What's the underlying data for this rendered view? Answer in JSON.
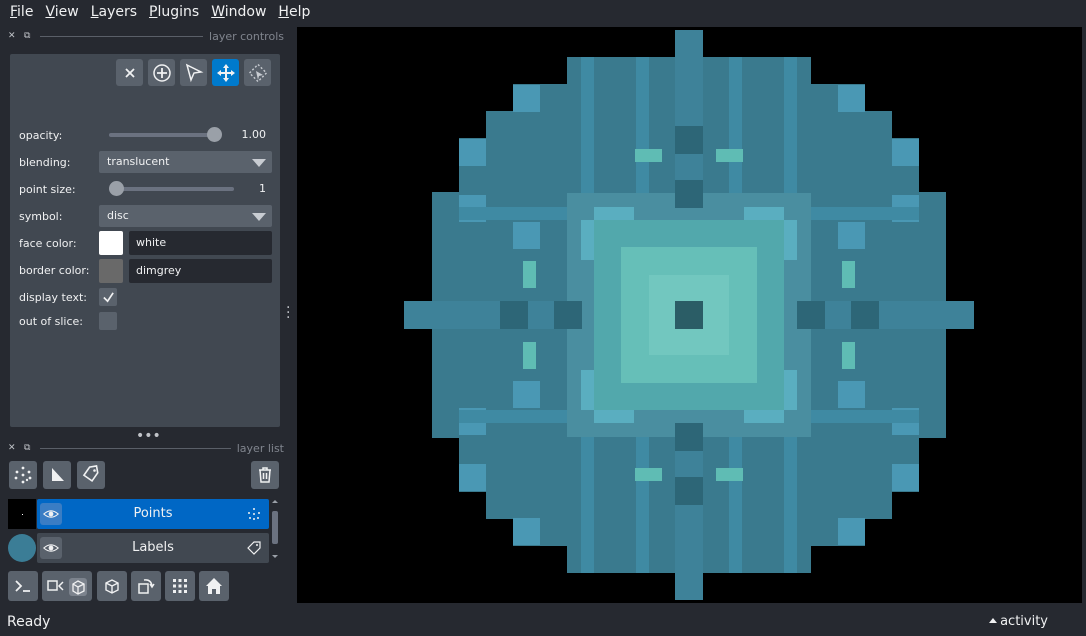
{
  "menu": [
    "File",
    "View",
    "Layers",
    "Plugins",
    "Window",
    "Help"
  ],
  "layer_controls": {
    "title": "layer controls",
    "opacity": {
      "label": "opacity:",
      "value": "1.00",
      "fraction": 1.0
    },
    "blending": {
      "label": "blending:",
      "value": "translucent"
    },
    "point_size": {
      "label": "point size:",
      "value": "1",
      "fraction": 0.0
    },
    "symbol": {
      "label": "symbol:",
      "value": "disc"
    },
    "face_color": {
      "label": "face color:",
      "value": "white",
      "swatch": "#ffffff"
    },
    "border_color": {
      "label": "border color:",
      "value": "dimgrey",
      "swatch": "#696969"
    },
    "display_text": {
      "label": "display text:",
      "checked": true
    },
    "out_of_slice": {
      "label": "out of slice:",
      "checked": false
    },
    "mode_buttons": [
      "delete-points",
      "add-points",
      "select-points",
      "pan-zoom",
      "transform"
    ],
    "active_mode": "pan-zoom"
  },
  "layer_list": {
    "title": "layer list",
    "layers": [
      {
        "name": "Points",
        "selected": true,
        "type_icon": "points-icon"
      },
      {
        "name": "Labels",
        "selected": false,
        "type_icon": "label-icon"
      }
    ]
  },
  "status": {
    "text": "Ready",
    "activity": "activity"
  },
  "colors": {
    "accent": "#007acc",
    "selected_layer": "#0067c5",
    "panel": "#414851",
    "background": "#262930"
  }
}
